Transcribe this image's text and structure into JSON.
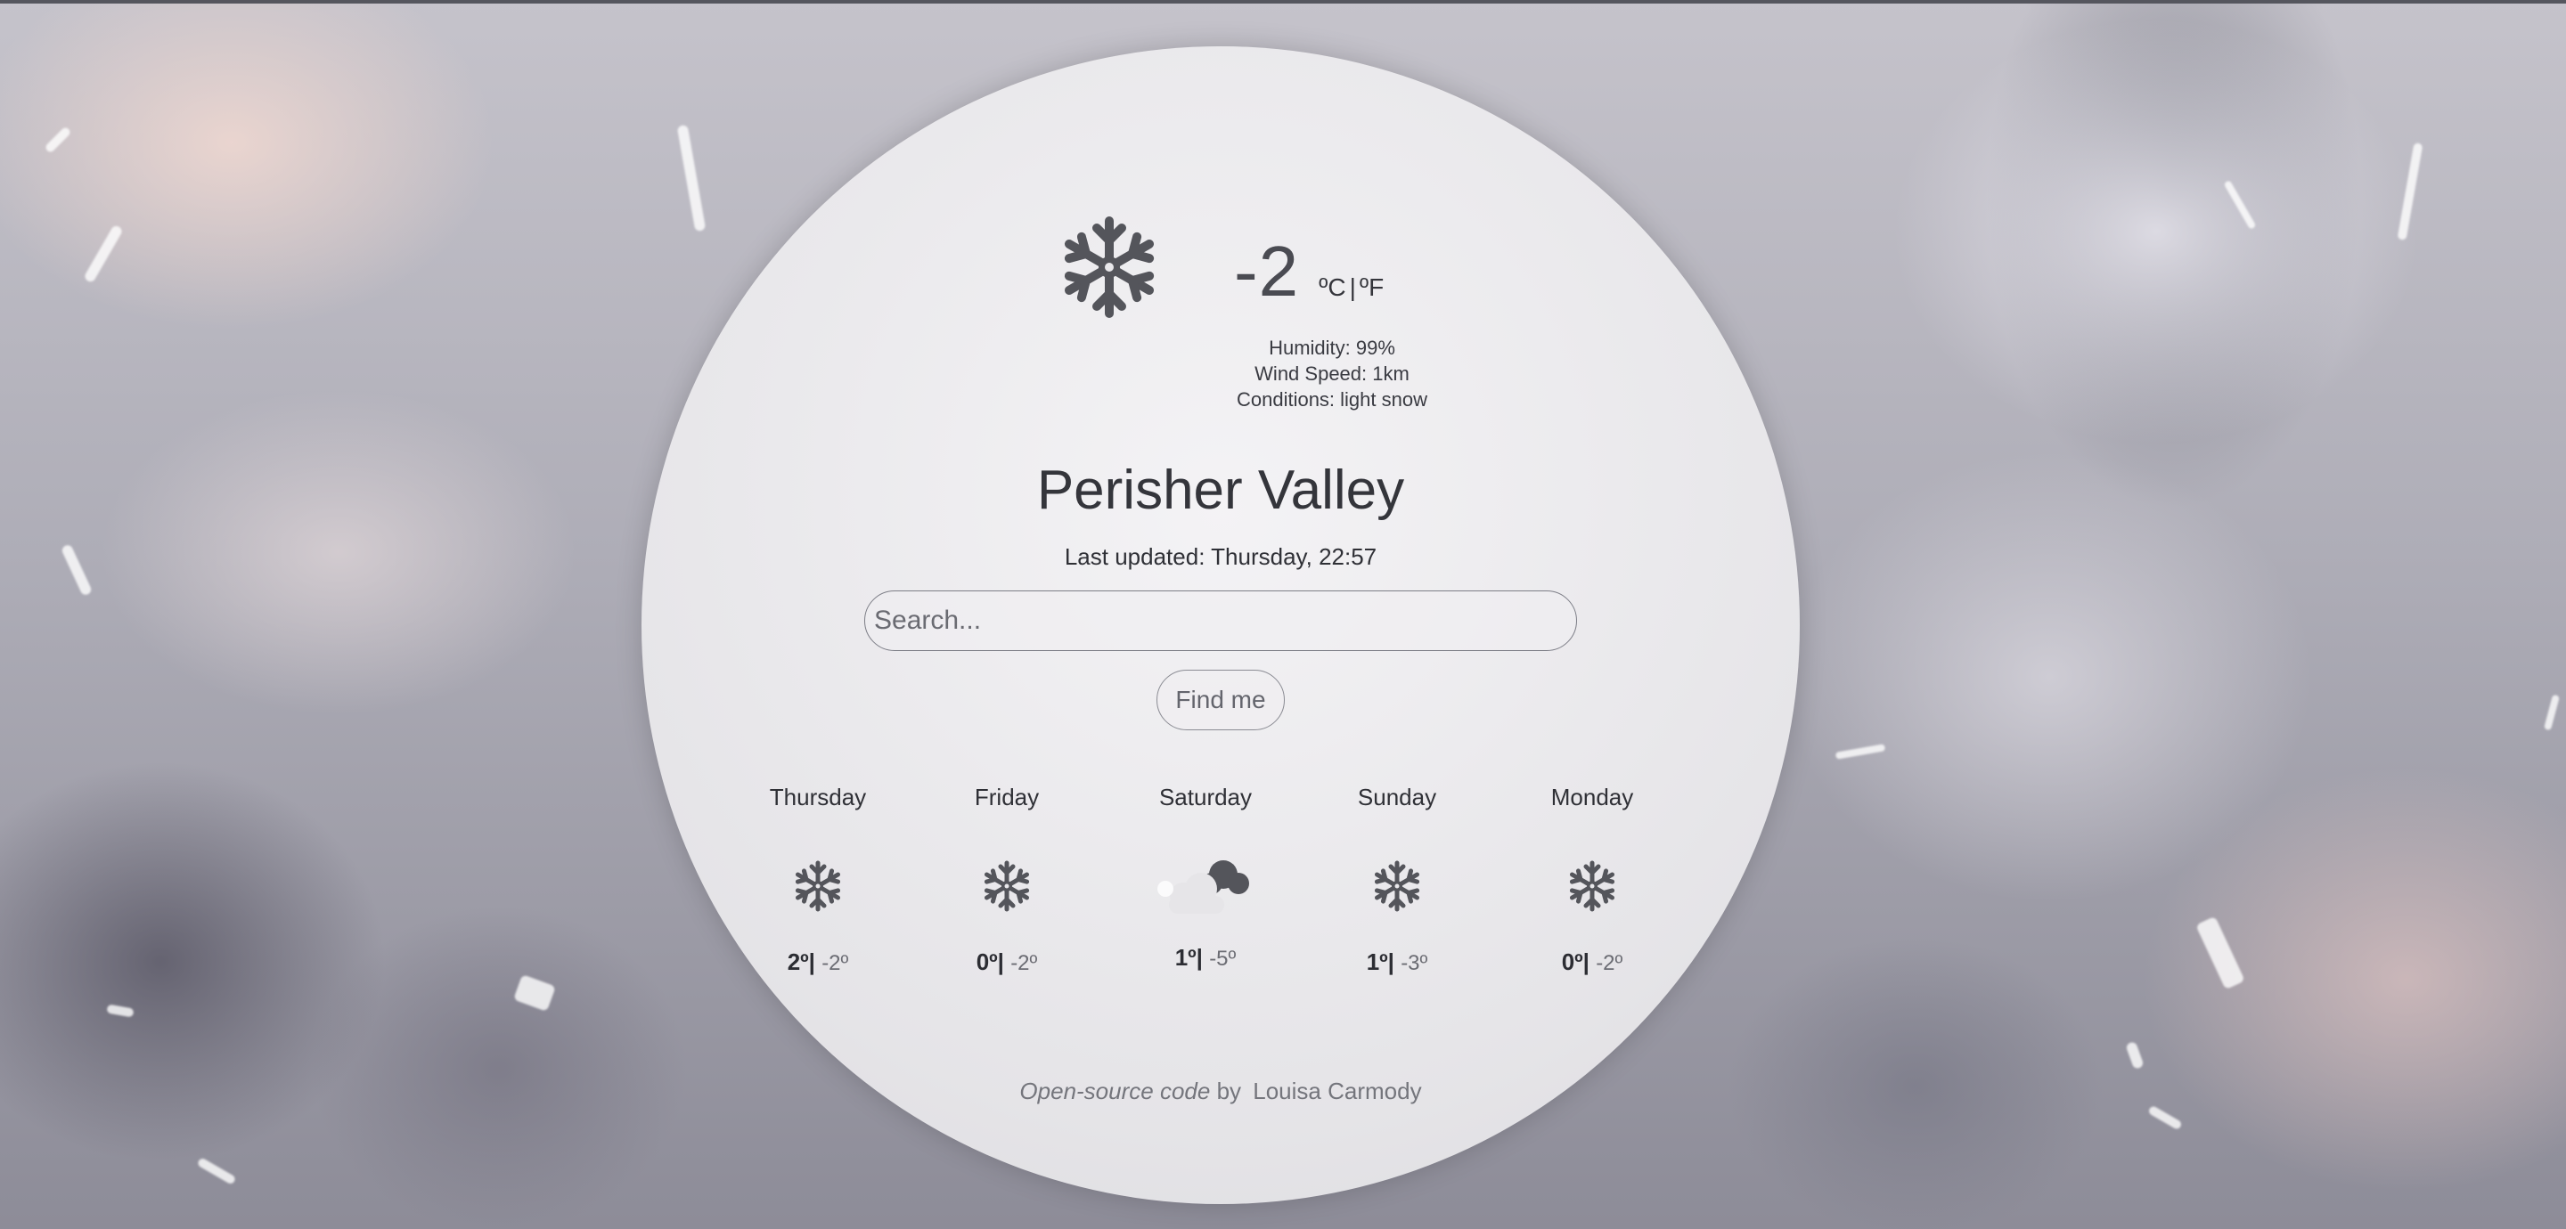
{
  "current": {
    "icon": "snowflake-icon",
    "temperature": "-2",
    "unit_celsius": "ºC",
    "unit_separator": "|",
    "unit_fahrenheit": "ºF",
    "humidity": "Humidity: 99%",
    "wind": "Wind Speed: 1km",
    "conditions": "Conditions: light snow"
  },
  "city": "Perisher Valley",
  "last_updated": "Last updated: Thursday, 22:57",
  "search": {
    "placeholder": "Search..."
  },
  "find_button": "Find me",
  "forecast": [
    {
      "day": "Thursday",
      "icon": "snowflake-icon",
      "high": "2º",
      "separator": "|",
      "low": "-2º"
    },
    {
      "day": "Friday",
      "icon": "snowflake-icon",
      "high": "0º",
      "separator": "|",
      "low": "-2º"
    },
    {
      "day": "Saturday",
      "icon": "cloud-icon",
      "high": "1º",
      "separator": "|",
      "low": "-5º"
    },
    {
      "day": "Sunday",
      "icon": "snowflake-icon",
      "high": "1º",
      "separator": "|",
      "low": "-3º"
    },
    {
      "day": "Monday",
      "icon": "snowflake-icon",
      "high": "0º",
      "separator": "|",
      "low": "-2º"
    }
  ],
  "footer": {
    "link_text": "Open-source code",
    "by": "by",
    "author": "Louisa Carmody"
  },
  "colors": {
    "icon": "#54555b",
    "text": "#34353b",
    "muted": "#74757c"
  }
}
